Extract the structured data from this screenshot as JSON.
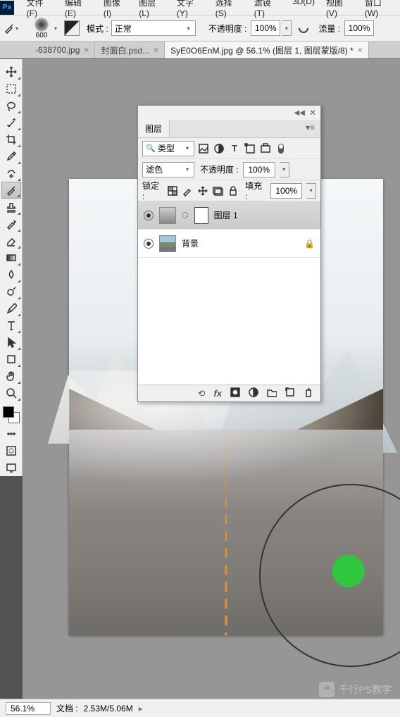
{
  "menu": {
    "items": [
      "文件(F)",
      "编辑(E)",
      "图像(I)",
      "图层(L)",
      "文字(Y)",
      "选择(S)",
      "滤镜(T)",
      "3D(D)",
      "视图(V)",
      "窗口(W)"
    ]
  },
  "options": {
    "brush_size": "600",
    "mode_label": "模式 :",
    "mode_value": "正常",
    "opacity_label": "不透明度 :",
    "opacity_value": "100%",
    "flow_label": "流量 :",
    "flow_value": "100%"
  },
  "tabs": [
    {
      "label": "-638700.jpg",
      "active": false
    },
    {
      "label": "封面白.psd...",
      "active": false
    },
    {
      "label": "SyE0O6EnM.jpg @ 56.1% (图层 1, 图层蒙版/8) *",
      "active": true
    }
  ],
  "tools": [
    {
      "name": "move-tool",
      "svg": "move"
    },
    {
      "name": "marquee-tool",
      "svg": "marquee"
    },
    {
      "name": "lasso-tool",
      "svg": "lasso"
    },
    {
      "name": "quick-select-tool",
      "svg": "wand"
    },
    {
      "name": "crop-tool",
      "svg": "crop"
    },
    {
      "name": "eyedropper-tool",
      "svg": "eyedrop"
    },
    {
      "name": "healing-brush-tool",
      "svg": "heal"
    },
    {
      "name": "brush-tool",
      "svg": "brush",
      "active": true
    },
    {
      "name": "clone-stamp-tool",
      "svg": "stamp"
    },
    {
      "name": "history-brush-tool",
      "svg": "hist"
    },
    {
      "name": "eraser-tool",
      "svg": "eraser"
    },
    {
      "name": "gradient-tool",
      "svg": "grad"
    },
    {
      "name": "blur-tool",
      "svg": "blur"
    },
    {
      "name": "dodge-tool",
      "svg": "dodge"
    },
    {
      "name": "pen-tool",
      "svg": "pen"
    },
    {
      "name": "type-tool",
      "svg": "type"
    },
    {
      "name": "path-select-tool",
      "svg": "pathsel"
    },
    {
      "name": "shape-tool",
      "svg": "shape"
    },
    {
      "name": "hand-tool",
      "svg": "hand"
    },
    {
      "name": "zoom-tool",
      "svg": "zoom"
    }
  ],
  "extras": [
    {
      "name": "edit-toolbar",
      "svg": "dots"
    },
    {
      "name": "quickmask-toggle",
      "svg": "qmask"
    },
    {
      "name": "screenmode-toggle",
      "svg": "screen"
    }
  ],
  "panel": {
    "title": "图层",
    "kind_label": "类型",
    "blend_mode": "滤色",
    "opacity_label": "不透明度 :",
    "opacity_value": "100%",
    "lock_label": "锁定 :",
    "fill_label": "填充 :",
    "fill_value": "100%",
    "layers": [
      {
        "name": "图层 1",
        "masked": true,
        "locked": false,
        "selected": true
      },
      {
        "name": "背景",
        "masked": false,
        "locked": true,
        "selected": false
      }
    ],
    "foot_icons": [
      "link",
      "fx",
      "mask",
      "adjust",
      "group",
      "new",
      "trash"
    ]
  },
  "status": {
    "zoom": "56.1%",
    "doc_label": "文档 :",
    "doc_value": "2.53M/5.06M"
  },
  "watermark": "千行PS教学"
}
